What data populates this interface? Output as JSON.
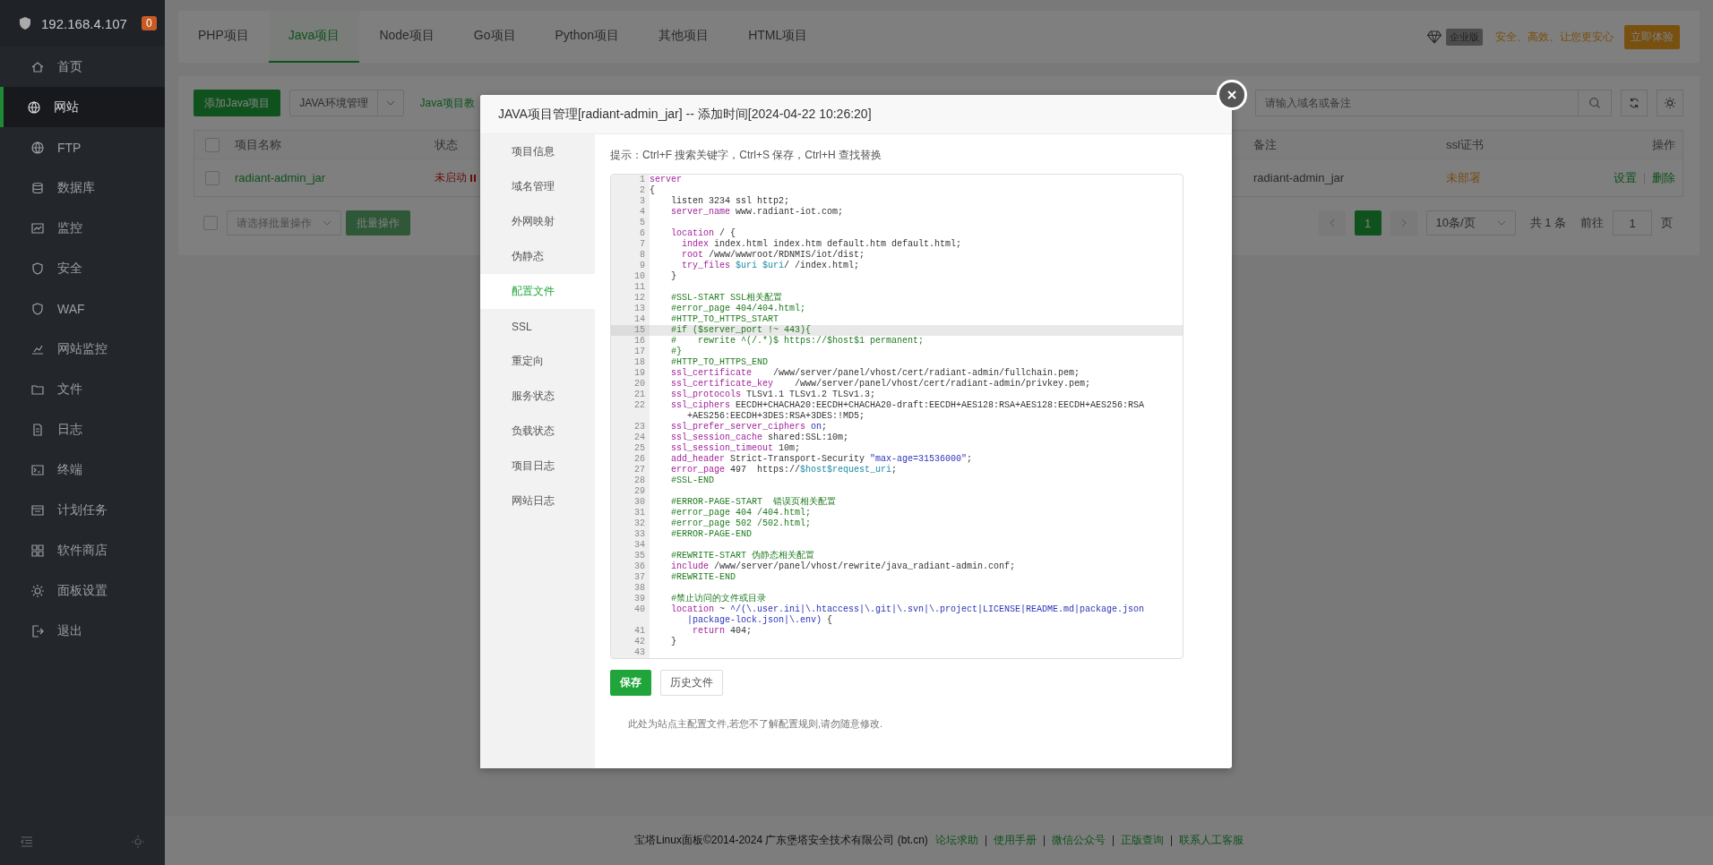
{
  "sidebar": {
    "host": "192.168.4.107",
    "badge": "0",
    "items": [
      {
        "label": "首页",
        "selected": false
      },
      {
        "label": "网站",
        "selected": true
      },
      {
        "label": "FTP",
        "selected": false
      },
      {
        "label": "数据库",
        "selected": false
      },
      {
        "label": "监控",
        "selected": false
      },
      {
        "label": "安全",
        "selected": false
      },
      {
        "label": "WAF",
        "selected": false
      },
      {
        "label": "网站监控",
        "selected": false
      },
      {
        "label": "文件",
        "selected": false
      },
      {
        "label": "日志",
        "selected": false
      },
      {
        "label": "终端",
        "selected": false
      },
      {
        "label": "计划任务",
        "selected": false
      },
      {
        "label": "软件商店",
        "selected": false
      },
      {
        "label": "面板设置",
        "selected": false
      },
      {
        "label": "退出",
        "selected": false
      }
    ]
  },
  "tabs": [
    {
      "label": "PHP项目",
      "selected": false
    },
    {
      "label": "Java项目",
      "selected": true
    },
    {
      "label": "Node项目",
      "selected": false
    },
    {
      "label": "Go项目",
      "selected": false
    },
    {
      "label": "Python项目",
      "selected": false
    },
    {
      "label": "其他项目",
      "selected": false
    },
    {
      "label": "HTML项目",
      "selected": false
    }
  ],
  "promo": {
    "edition": "企业版",
    "slogan": "安全、高效、让您更安心",
    "button": "立即体验"
  },
  "toolbar": {
    "add_button": "添加Java项目",
    "env_button": "JAVA环境管理",
    "tutorial_link": "Java项目教",
    "search": {
      "placeholder": "请输入域名或备注"
    }
  },
  "table": {
    "header_checked": false,
    "columns": [
      "项目名称",
      "状态",
      "备注",
      "ssl证书",
      "操作"
    ],
    "rows": [
      {
        "checked": false,
        "name": "radiant-admin_jar",
        "status": "未启动",
        "running": false,
        "remark": "radiant-admin_jar",
        "ssl": "未部署",
        "actions": [
          "设置",
          "删除"
        ]
      }
    ]
  },
  "batch": {
    "checked": false,
    "placeholder": "请选择批量操作",
    "button": "批量操作",
    "disabled": true
  },
  "pagination": {
    "pages": [
      {
        "label": "1",
        "selected": true
      }
    ],
    "page_size": "10条/页",
    "total": "共 1 条",
    "goto_label": "前往",
    "goto_value": "1",
    "page_suffix": "页"
  },
  "modal": {
    "title": "JAVA项目管理[radiant-admin_jar] -- 添加时间[2024-04-22 10:26:20]",
    "nav": [
      {
        "label": "项目信息",
        "selected": false
      },
      {
        "label": "域名管理",
        "selected": false
      },
      {
        "label": "外网映射",
        "selected": false
      },
      {
        "label": "伪静态",
        "selected": false
      },
      {
        "label": "配置文件",
        "selected": true
      },
      {
        "label": "SSL",
        "selected": false
      },
      {
        "label": "重定向",
        "selected": false
      },
      {
        "label": "服务状态",
        "selected": false
      },
      {
        "label": "负载状态",
        "selected": false
      },
      {
        "label": "项目日志",
        "selected": false
      },
      {
        "label": "网站日志",
        "selected": false
      }
    ],
    "tip": "提示：Ctrl+F 搜索关键字，Ctrl+S 保存，Ctrl+H 查找替换",
    "editor": {
      "lines": [
        {
          "number": "1",
          "active": false,
          "tokens": [
            {
              "kind": "keyword",
              "text": "server"
            }
          ]
        },
        {
          "number": "2",
          "active": false,
          "tokens": [
            {
              "kind": "plain",
              "text": "{"
            }
          ]
        },
        {
          "number": "3",
          "active": false,
          "tokens": [
            {
              "kind": "plain",
              "text": "    listen 3234 ssl http2;"
            }
          ]
        },
        {
          "number": "4",
          "active": false,
          "tokens": [
            {
              "kind": "keyword",
              "text": "    server_name"
            },
            {
              "kind": "plain",
              "text": " www.radiant-iot.com;"
            }
          ]
        },
        {
          "number": "5",
          "active": false
        },
        {
          "number": "6",
          "active": false,
          "tokens": [
            {
              "kind": "keyword",
              "text": "    location"
            },
            {
              "kind": "plain",
              "text": " / {"
            }
          ]
        },
        {
          "number": "7",
          "active": false,
          "tokens": [
            {
              "kind": "keyword",
              "text": "      index"
            },
            {
              "kind": "plain",
              "text": " index.html index.htm default.htm default.html;"
            }
          ]
        },
        {
          "number": "8",
          "active": false,
          "tokens": [
            {
              "kind": "keyword",
              "text": "      root"
            },
            {
              "kind": "plain",
              "text": " /www/wwwroot/RDNMIS/iot/dist;"
            }
          ]
        },
        {
          "number": "9",
          "active": false,
          "tokens": [
            {
              "kind": "keyword",
              "text": "      try_files"
            },
            {
              "kind": "variable",
              "text": " $uri"
            },
            {
              "kind": "variable",
              "text": " $uri"
            },
            {
              "kind": "plain",
              "text": "/ /index.html;"
            }
          ]
        },
        {
          "number": "10",
          "active": false,
          "tokens": [
            {
              "kind": "plain",
              "text": "    }"
            }
          ]
        },
        {
          "number": "11",
          "active": false
        },
        {
          "number": "12",
          "active": false,
          "tokens": [
            {
              "kind": "comment",
              "text": "    #SSL-START SSL相关配置"
            }
          ]
        },
        {
          "number": "13",
          "active": false,
          "tokens": [
            {
              "kind": "comment",
              "text": "    #error_page 404/404.html;"
            }
          ]
        },
        {
          "number": "14",
          "active": false,
          "tokens": [
            {
              "kind": "comment",
              "text": "    #HTTP_TO_HTTPS_START"
            }
          ]
        },
        {
          "number": "15",
          "active": true,
          "tokens": [
            {
              "kind": "comment",
              "text": "    #if ($server_port !~ 443){"
            }
          ]
        },
        {
          "number": "16",
          "active": false,
          "tokens": [
            {
              "kind": "comment",
              "text": "    #    rewrite ^(/.*)$ https://$host$1 permanent;"
            }
          ]
        },
        {
          "number": "17",
          "active": false,
          "tokens": [
            {
              "kind": "comment",
              "text": "    #}"
            }
          ]
        },
        {
          "number": "18",
          "active": false,
          "tokens": [
            {
              "kind": "comment",
              "text": "    #HTTP_TO_HTTPS_END"
            }
          ]
        },
        {
          "number": "19",
          "active": false,
          "tokens": [
            {
              "kind": "keyword",
              "text": "    ssl_certificate"
            },
            {
              "kind": "plain",
              "text": "    /www/server/panel/vhost/cert/radiant-admin/fullchain.pem;"
            }
          ]
        },
        {
          "number": "20",
          "active": false,
          "tokens": [
            {
              "kind": "keyword",
              "text": "    ssl_certificate_key"
            },
            {
              "kind": "plain",
              "text": "    /www/server/panel/vhost/cert/radiant-admin/privkey.pem;"
            }
          ]
        },
        {
          "number": "21",
          "active": false,
          "tokens": [
            {
              "kind": "keyword",
              "text": "    ssl_protocols"
            },
            {
              "kind": "plain",
              "text": " TLSv1.1 TLSv1.2 TLSv1.3;"
            }
          ]
        },
        {
          "number": "22",
          "active": false,
          "tokens": [
            {
              "kind": "keyword",
              "text": "    ssl_ciphers"
            },
            {
              "kind": "plain",
              "text": " EECDH+CHACHA20:EECDH+CHACHA20-draft:EECDH+AES128:RSA+AES128:EECDH+AES256:RSA+AES256:EECDH+3DES:RSA+3DES:!MD5;"
            }
          ]
        },
        {
          "number": "23",
          "active": false,
          "tokens": [
            {
              "kind": "keyword",
              "text": "    ssl_prefer_server_ciphers"
            },
            {
              "kind": "string",
              "text": " on"
            },
            {
              "kind": "plain",
              "text": ";"
            }
          ]
        },
        {
          "number": "24",
          "active": false,
          "tokens": [
            {
              "kind": "keyword",
              "text": "    ssl_session_cache"
            },
            {
              "kind": "plain",
              "text": " shared:SSL:10m;"
            }
          ]
        },
        {
          "number": "25",
          "active": false,
          "tokens": [
            {
              "kind": "keyword",
              "text": "    ssl_session_timeout"
            },
            {
              "kind": "plain",
              "text": " 10m;"
            }
          ]
        },
        {
          "number": "26",
          "active": false,
          "tokens": [
            {
              "kind": "keyword",
              "text": "    add_header"
            },
            {
              "kind": "plain",
              "text": " Strict-Transport-Security "
            },
            {
              "kind": "string",
              "text": "\"max-age=31536000\""
            },
            {
              "kind": "plain",
              "text": ";"
            }
          ]
        },
        {
          "number": "27",
          "active": false,
          "tokens": [
            {
              "kind": "keyword",
              "text": "    error_page"
            },
            {
              "kind": "plain",
              "text": " 497  https://"
            },
            {
              "kind": "variable",
              "text": "$host$request_uri"
            },
            {
              "kind": "plain",
              "text": ";"
            }
          ]
        },
        {
          "number": "28",
          "active": false,
          "tokens": [
            {
              "kind": "comment",
              "text": "    #SSL-END"
            }
          ]
        },
        {
          "number": "29",
          "active": false
        },
        {
          "number": "30",
          "active": false,
          "tokens": [
            {
              "kind": "comment",
              "text": "    #ERROR-PAGE-START  错误页相关配置"
            }
          ]
        },
        {
          "number": "31",
          "active": false,
          "tokens": [
            {
              "kind": "comment",
              "text": "    #error_page 404 /404.html;"
            }
          ]
        },
        {
          "number": "32",
          "active": false,
          "tokens": [
            {
              "kind": "comment",
              "text": "    #error_page 502 /502.html;"
            }
          ]
        },
        {
          "number": "33",
          "active": false,
          "tokens": [
            {
              "kind": "comment",
              "text": "    #ERROR-PAGE-END"
            }
          ]
        },
        {
          "number": "34",
          "active": false
        },
        {
          "number": "35",
          "active": false,
          "tokens": [
            {
              "kind": "comment",
              "text": "    #REWRITE-START 伪静态相关配置"
            }
          ]
        },
        {
          "number": "36",
          "active": false,
          "tokens": [
            {
              "kind": "keyword",
              "text": "    include"
            },
            {
              "kind": "plain",
              "text": " /www/server/panel/vhost/rewrite/java_radiant-admin.conf;"
            }
          ]
        },
        {
          "number": "37",
          "active": false,
          "tokens": [
            {
              "kind": "comment",
              "text": "    #REWRITE-END"
            }
          ]
        },
        {
          "number": "38",
          "active": false
        },
        {
          "number": "39",
          "active": false,
          "tokens": [
            {
              "kind": "comment",
              "text": "    #禁止访问的文件或目录"
            }
          ]
        },
        {
          "number": "40",
          "active": false,
          "tokens": [
            {
              "kind": "keyword",
              "text": "    location"
            },
            {
              "kind": "plain",
              "text": " ~ "
            },
            {
              "kind": "string",
              "text": "^/(\\.user.ini|\\.htaccess|\\.git|\\.svn|\\.project|LICENSE|README.md|package.json|package-lock.json|\\.env)"
            },
            {
              "kind": "plain",
              "text": " {"
            }
          ]
        },
        {
          "number": "41",
          "active": false,
          "tokens": [
            {
              "kind": "keyword",
              "text": "        return"
            },
            {
              "kind": "plain",
              "text": " 404;"
            }
          ]
        },
        {
          "number": "42",
          "active": false,
          "tokens": [
            {
              "kind": "plain",
              "text": "    }"
            }
          ]
        },
        {
          "number": "43",
          "active": false
        }
      ]
    },
    "buttons": [
      {
        "label": "保存",
        "kind": "primary"
      },
      {
        "label": "历史文件",
        "kind": "default"
      }
    ],
    "note": "此处为站点主配置文件,若您不了解配置规则,请勿随意修改."
  },
  "footer": {
    "copyright": "宝塔Linux面板©2014-2024 广东堡塔安全技术有限公司 (bt.cn)",
    "links": [
      "论坛求助",
      "使用手册",
      "微信公众号",
      "正版查询",
      "联系人工客服"
    ]
  }
}
